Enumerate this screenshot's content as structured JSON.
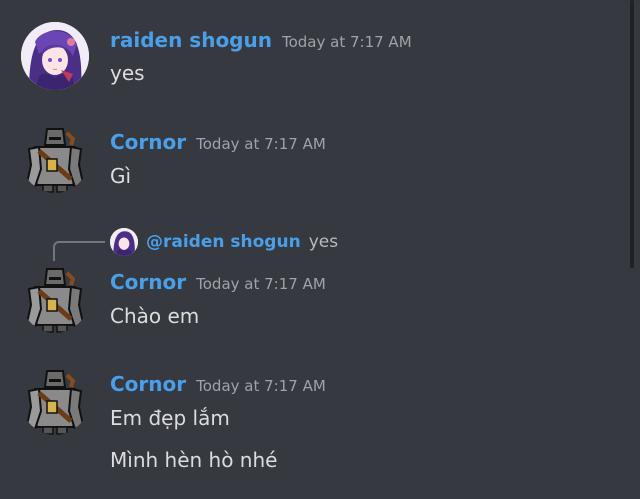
{
  "messages": [
    {
      "author": "raiden shogun",
      "timestamp": "Today at 7:17 AM",
      "lines": [
        "yes"
      ]
    },
    {
      "author": "Cornor",
      "timestamp": "Today at 7:17 AM",
      "lines": [
        "Gì"
      ]
    },
    {
      "reply": {
        "mention": "@raiden shogun",
        "text": "yes"
      },
      "author": "Cornor",
      "timestamp": "Today at 7:17 AM",
      "lines": [
        "Chào em"
      ]
    },
    {
      "author": "Cornor",
      "timestamp": "Today at 7:17 AM",
      "lines": [
        "Em đẹp lắm",
        "Mình hèn hò nhé"
      ]
    }
  ],
  "colors": {
    "background": "#36393f",
    "username": "#4a9fe8",
    "timestamp": "#9fa2a8",
    "text": "#dcddde"
  }
}
